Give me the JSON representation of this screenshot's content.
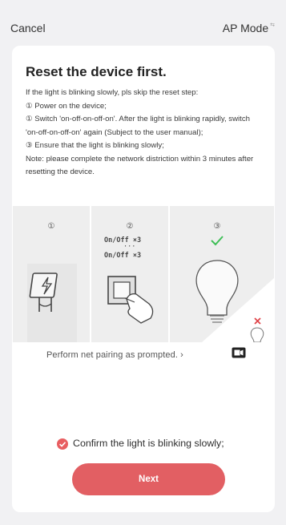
{
  "header": {
    "cancel_label": "Cancel",
    "mode_label": "AP Mode",
    "mode_suffix": "⇆"
  },
  "content": {
    "title": "Reset the device first.",
    "instructions": [
      "If the light is blinking slowly, pls skip the reset step:",
      "① Power on the device;",
      "① Switch 'on-off-on-off-on'. After the light is blinking rapidly, switch 'on-off-on-off-on' again (Subject to the user manual);",
      "③ Ensure that the light is blinking slowly;",
      "Note: please complete the network distriction within 3 minutes after resetting the device."
    ]
  },
  "illustration": {
    "steps": [
      "①",
      "②",
      "③"
    ],
    "onoff_line1": "On/Off ×3",
    "onoff_dots": "···",
    "onoff_line2": "On/Off ×3"
  },
  "prompt": {
    "text": "Perform net pairing as prompted. ›"
  },
  "confirm": {
    "text": "Confirm the light is blinking slowly;",
    "checked": true
  },
  "footer": {
    "next_label": "Next"
  },
  "colors": {
    "accent": "#e25f63",
    "check_green": "#3fbf57",
    "cross_red": "#e0454a"
  }
}
